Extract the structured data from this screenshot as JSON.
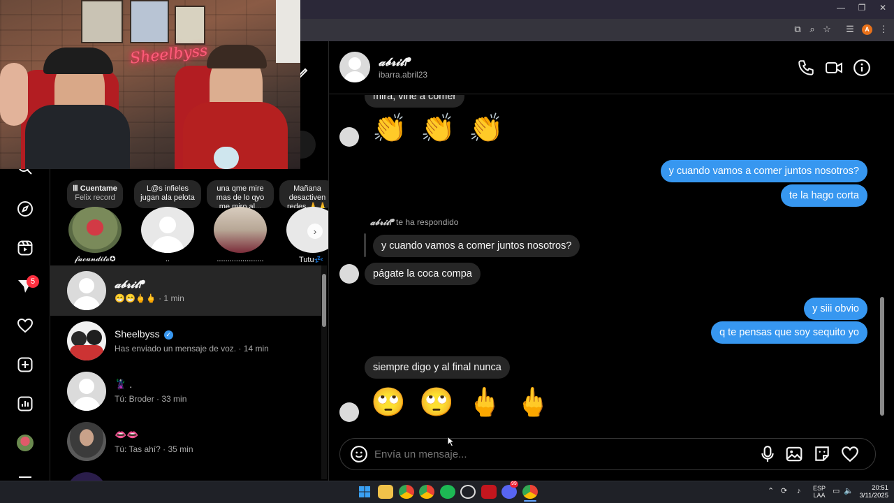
{
  "colors": {
    "accent_blue": "#3797f0",
    "incoming_bubble": "#262626",
    "badge_red": "#ff3040",
    "background": "#000000"
  },
  "webcam": {
    "neon_sign": "Sheelbyss"
  },
  "nav": {
    "items": [
      "search-icon",
      "explore-icon",
      "reels-icon",
      "messages-icon",
      "notifications-icon",
      "create-icon",
      "dashboard-icon",
      "profile-avatar",
      "more-icon"
    ],
    "messages_badge": "5"
  },
  "notes": [
    {
      "prefix": "Ⅲ",
      "text": "Cuentame",
      "sub": "Felix record",
      "name": "𝓯𝓪𝓬𝓾𝓷𝓭𝓲𝓽𝓸✪"
    },
    {
      "text": "L@s infieles jugan ala pelota",
      "name": ".."
    },
    {
      "text": "una qme mire mas de lo qyo me miro al...",
      "name": "......................"
    },
    {
      "text": "Mañana desactiven redes 🙏🙏",
      "name": "Tutu💤"
    }
  ],
  "conversations": [
    {
      "name": "𝓪𝓫𝓻𝓲𝓵ᖰ",
      "sub": "😁😁🖕🖕 · 1 min",
      "active": true
    },
    {
      "name": "Sheelbyss",
      "sub": "Has enviado un mensaje de voz. · 14 min",
      "verified": true
    },
    {
      "name": "🦹‍♂️ .",
      "sub": "Tú: Broder · 33 min"
    },
    {
      "name": "👄👄",
      "sub": "Tú: Tas ahí? · 35 min"
    }
  ],
  "chat": {
    "header": {
      "name": "𝓪𝓫𝓻𝓲𝓵ᖰ",
      "username": "ibarra.abril23"
    },
    "clipped_top": "mirá, vine a comer",
    "clap_emojis": [
      "👏",
      "👏",
      "👏"
    ],
    "out1": "y cuando vamos a comer juntos nosotros?",
    "out2": "te la hago corta",
    "reply_name": "𝓪𝓫𝓻𝓲𝓵ᖰ",
    "reply_text": "te ha respondido",
    "quoted": "y cuando vamos a comer juntos nosotros?",
    "in1": "págate la coca compa",
    "out3": "y siii obvio",
    "out4": "q te pensas que soy sequito yo",
    "in2": "siempre digo y al final nunca",
    "last_emojis": [
      "🙄",
      "🙄",
      "🖕",
      "🖕"
    ]
  },
  "composer": {
    "placeholder": "Envía un mensaje..."
  },
  "taskbar": {
    "lang": "ESP",
    "lang_sub": "LAA",
    "time": "20:51",
    "date": "3/11/2025",
    "discord_badge": "99"
  }
}
